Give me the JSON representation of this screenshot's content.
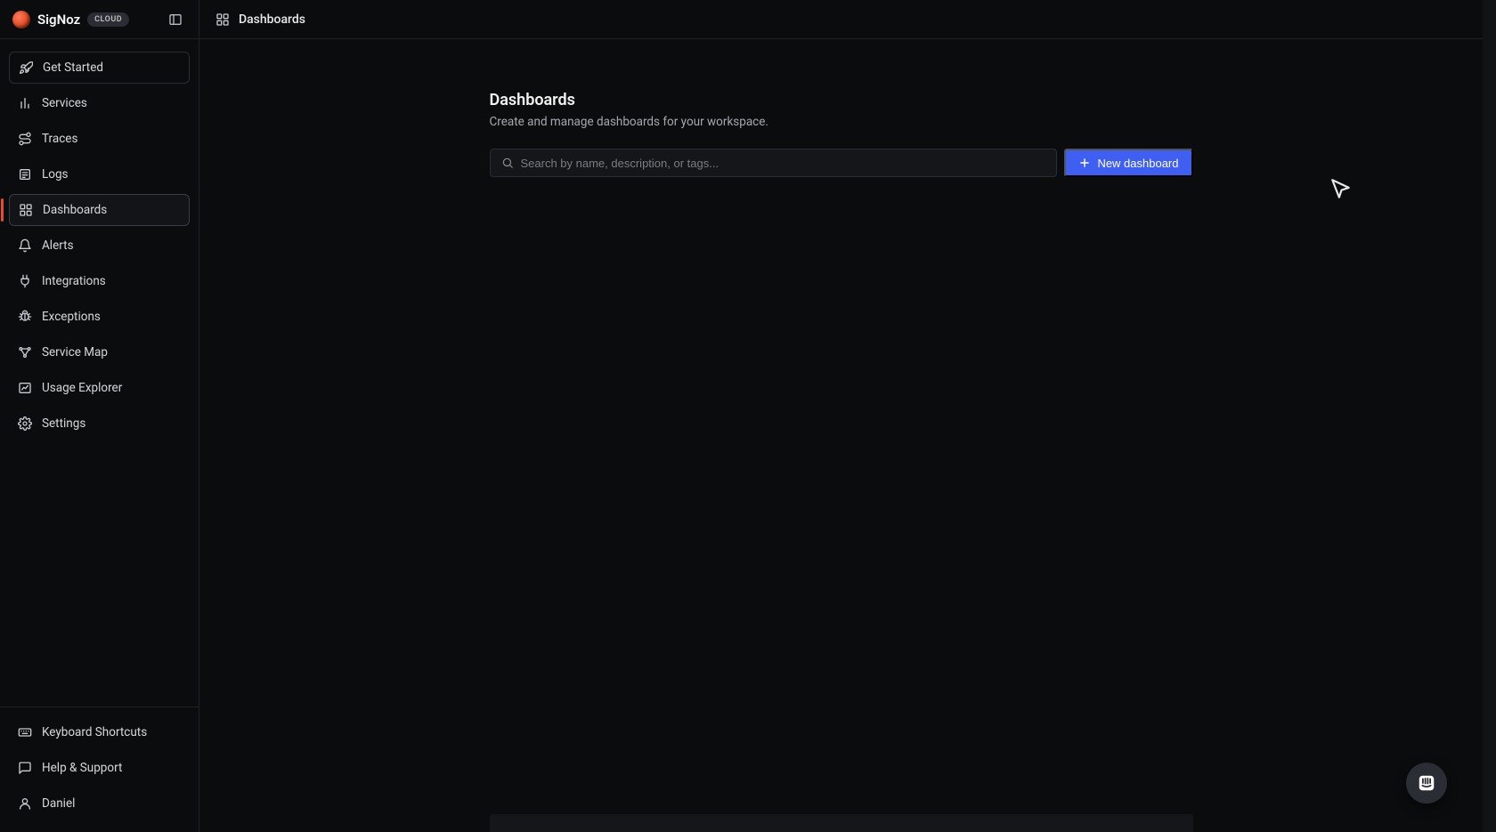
{
  "brand": {
    "name": "SigNoz",
    "badge": "CLOUD"
  },
  "sidebar": {
    "items": [
      {
        "label": "Get Started",
        "icon": "rocket"
      },
      {
        "label": "Services",
        "icon": "bar-chart"
      },
      {
        "label": "Traces",
        "icon": "route"
      },
      {
        "label": "Logs",
        "icon": "logs"
      },
      {
        "label": "Dashboards",
        "icon": "layout-grid"
      },
      {
        "label": "Alerts",
        "icon": "bell"
      },
      {
        "label": "Integrations",
        "icon": "plug"
      },
      {
        "label": "Exceptions",
        "icon": "bug"
      },
      {
        "label": "Service Map",
        "icon": "map"
      },
      {
        "label": "Usage Explorer",
        "icon": "gauge"
      },
      {
        "label": "Settings",
        "icon": "gear"
      }
    ],
    "footer": [
      {
        "label": "Keyboard Shortcuts",
        "icon": "keyboard"
      },
      {
        "label": "Help & Support",
        "icon": "message"
      },
      {
        "label": "Daniel",
        "icon": "user"
      }
    ],
    "active_index": 4,
    "boxed_index": 0
  },
  "topbar": {
    "title": "Dashboards"
  },
  "page": {
    "title": "Dashboards",
    "subtitle": "Create and manage dashboards for your workspace."
  },
  "search": {
    "value": "",
    "placeholder": "Search by name, description, or tags..."
  },
  "buttons": {
    "new_dashboard": "New dashboard"
  },
  "colors": {
    "accent": "#3f5ef2",
    "accent_sidebar": "#e44d26"
  }
}
